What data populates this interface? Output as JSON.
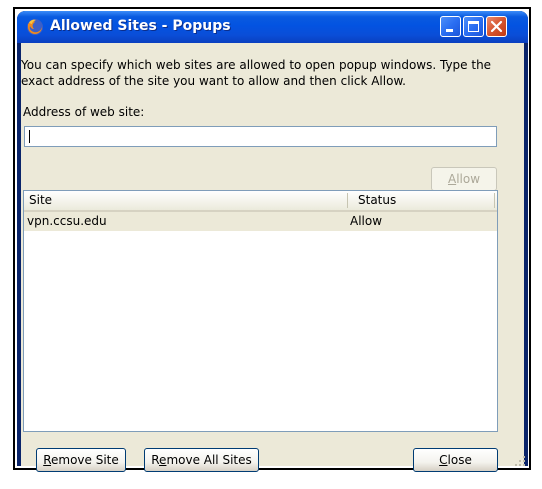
{
  "window": {
    "title": "Allowed Sites - Popups",
    "icon": "firefox-icon",
    "controls": [
      "minimize-icon",
      "maximize-icon",
      "close-icon"
    ]
  },
  "description": "You can specify which web sites are allowed to open popup windows. Type the exact address of the site you want to allow and then click Allow.",
  "address": {
    "label": "Address of web site:",
    "value": "",
    "placeholder": ""
  },
  "allow_button": {
    "label": "Allow",
    "accesskey": "A",
    "rest": "llow",
    "enabled": false
  },
  "list": {
    "columns": [
      "Site",
      "Status"
    ],
    "rows": [
      {
        "site": "vpn.ccsu.edu",
        "status": "Allow"
      }
    ]
  },
  "buttons": {
    "remove_site": {
      "label": "Remove Site",
      "accesskey": "R",
      "rest": "emove Site"
    },
    "remove_all": {
      "label": "Remove All Sites",
      "pre": "R",
      "accesskey": "e",
      "rest": "move All Sites"
    },
    "close": {
      "label": "Close",
      "accesskey": "C",
      "rest": "lose"
    }
  },
  "colors": {
    "titlebar": "#0a5be0",
    "client": "#ece9d8",
    "selected_row": "#ece9d8"
  }
}
